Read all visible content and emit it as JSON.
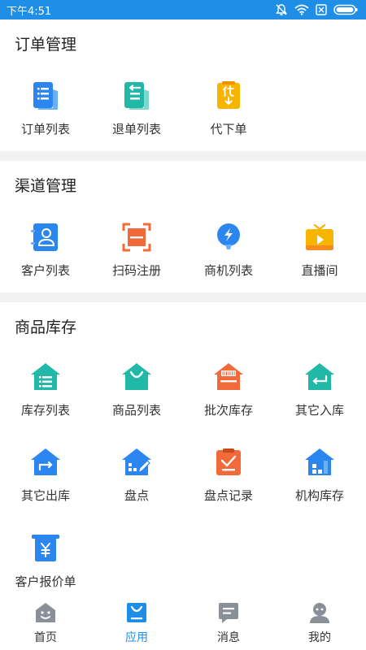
{
  "status_bar": {
    "time": "下午4:51"
  },
  "sections": [
    {
      "title": "订单管理",
      "items": [
        {
          "label": "订单列表",
          "icon": "order-list-icon"
        },
        {
          "label": "退单列表",
          "icon": "return-list-icon"
        },
        {
          "label": "代下单",
          "icon": "proxy-order-icon"
        }
      ]
    },
    {
      "title": "渠道管理",
      "items": [
        {
          "label": "客户列表",
          "icon": "customer-list-icon"
        },
        {
          "label": "扫码注册",
          "icon": "scan-register-icon"
        },
        {
          "label": "商机列表",
          "icon": "opportunity-list-icon"
        },
        {
          "label": "直播间",
          "icon": "live-room-icon"
        }
      ]
    },
    {
      "title": "商品库存",
      "items": [
        {
          "label": "库存列表",
          "icon": "inventory-list-icon"
        },
        {
          "label": "商品列表",
          "icon": "product-list-icon"
        },
        {
          "label": "批次库存",
          "icon": "batch-inventory-icon"
        },
        {
          "label": "其它入库",
          "icon": "other-inbound-icon"
        },
        {
          "label": "其它出库",
          "icon": "other-outbound-icon"
        },
        {
          "label": "盘点",
          "icon": "stocktake-icon"
        },
        {
          "label": "盘点记录",
          "icon": "stocktake-record-icon"
        },
        {
          "label": "机构库存",
          "icon": "org-inventory-icon"
        },
        {
          "label": "客户报价单",
          "icon": "customer-quote-icon"
        }
      ]
    }
  ],
  "tabbar": [
    {
      "label": "首页",
      "icon": "home-icon",
      "active": false
    },
    {
      "label": "应用",
      "icon": "apps-icon",
      "active": true
    },
    {
      "label": "消息",
      "icon": "message-icon",
      "active": false
    },
    {
      "label": "我的",
      "icon": "profile-icon",
      "active": false
    }
  ],
  "colors": {
    "status_bar": "#1e8ee6",
    "accent": "#1e8ee6",
    "blue": "#2b86f0",
    "teal": "#22b8a8",
    "orange": "#f26a3a",
    "yellow": "#f7b500",
    "gray": "#8a9099"
  }
}
